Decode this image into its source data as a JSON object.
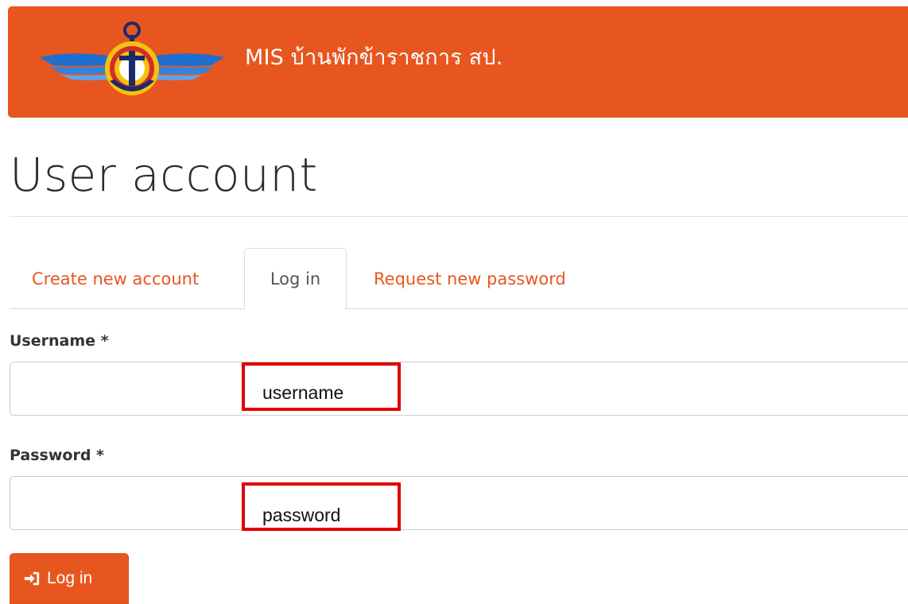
{
  "header": {
    "site_name": "MIS บ้านพักข้าราชการ สป.",
    "logo_icon": "wings-anchor-emblem-icon",
    "brand_color": "#e8561f"
  },
  "page": {
    "title": "User account"
  },
  "tabs": [
    {
      "label": "Create new account",
      "active": false
    },
    {
      "label": "Log in",
      "active": true
    },
    {
      "label": "Request new password",
      "active": false
    }
  ],
  "form": {
    "username": {
      "label": "Username *",
      "value": "",
      "annotation": "username"
    },
    "password": {
      "label": "Password *",
      "value": "",
      "annotation": "password"
    },
    "submit": {
      "label": "Log in",
      "icon": "sign-in-icon"
    }
  },
  "colors": {
    "accent": "#e8561f",
    "annotation_border": "#e00000"
  }
}
